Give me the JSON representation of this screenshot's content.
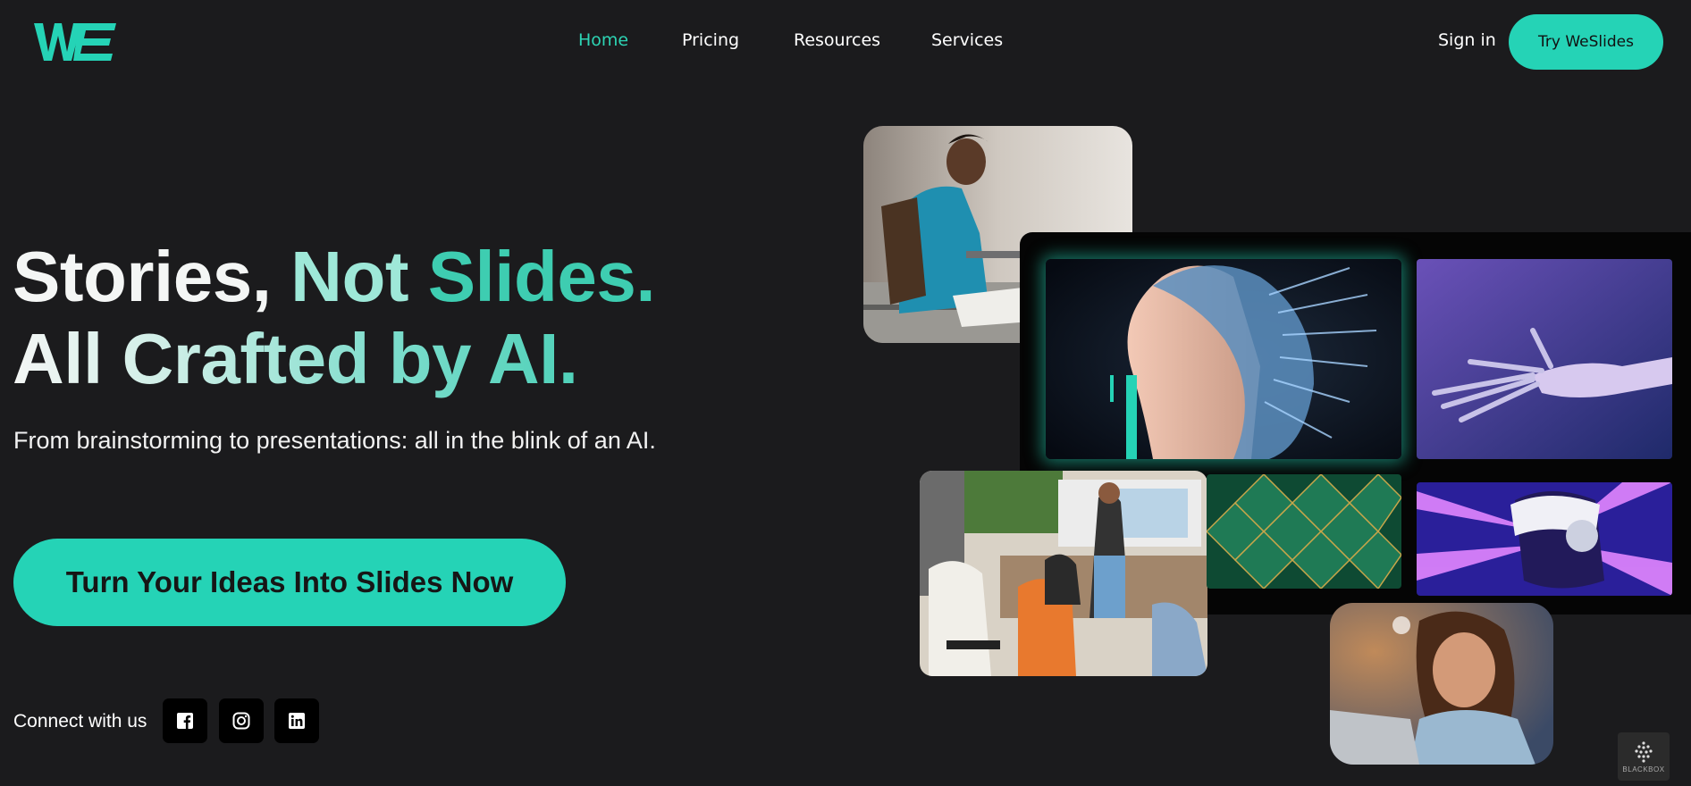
{
  "brand": {
    "logo_text": "WE",
    "accent": "#25d3b6"
  },
  "nav": {
    "items": [
      {
        "label": "Home",
        "active": true
      },
      {
        "label": "Pricing",
        "active": false
      },
      {
        "label": "Resources",
        "active": false
      },
      {
        "label": "Services",
        "active": false
      }
    ]
  },
  "header": {
    "signin_label": "Sign in",
    "try_label": "Try WeSlides"
  },
  "hero": {
    "title_word1": "Stories,",
    "title_word2": "Not",
    "title_word3": "Slides.",
    "title_line2": "All Crafted by AI.",
    "subtitle": "From brainstorming to presentations: all in the blink of an AI.",
    "cta_label": "Turn Your Ideas Into Slides Now"
  },
  "social": {
    "label": "Connect with us",
    "icons": [
      "facebook-icon",
      "instagram-icon",
      "linkedin-icon"
    ]
  },
  "badge": {
    "label": "BLACKBOX"
  }
}
